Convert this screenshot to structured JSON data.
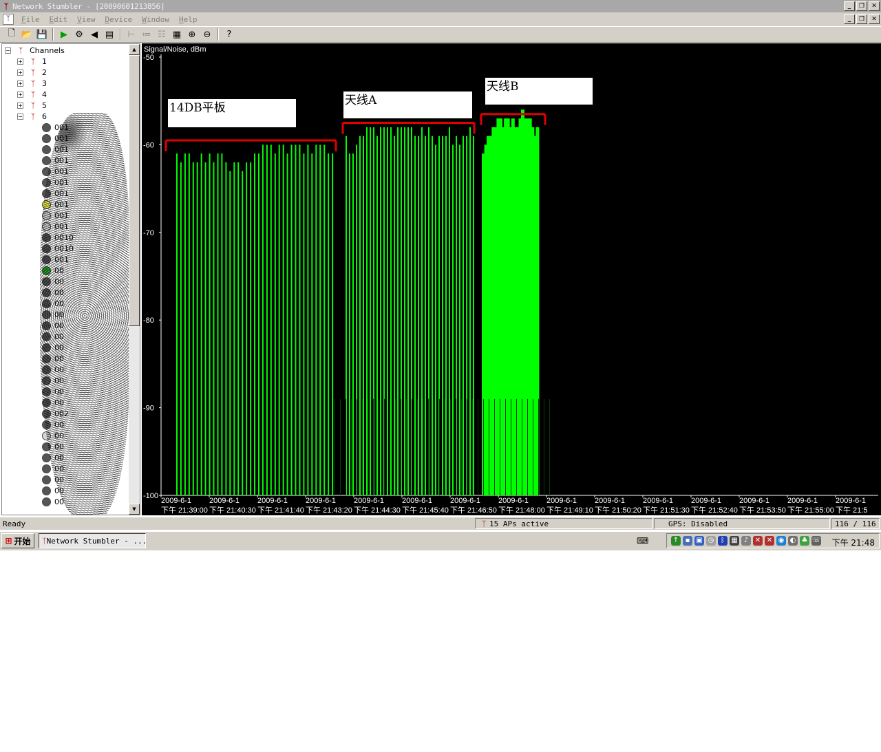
{
  "window": {
    "title": "Network Stumbler - [20090601213856]",
    "controls": [
      "_",
      "❐",
      "✕"
    ]
  },
  "menu": {
    "items": [
      "File",
      "Edit",
      "View",
      "Device",
      "Window",
      "Help"
    ]
  },
  "toolbar": {
    "icons": [
      "new-icon",
      "open-icon",
      "save-icon",
      "play-icon",
      "auto-config-icon",
      "scan-speed-icon",
      "properties-icon",
      "tree-icon",
      "list-icon",
      "columns-icon",
      "grid-icon",
      "zoom-in-icon",
      "zoom-out-icon",
      "help-icon"
    ]
  },
  "tree": {
    "root_label": "Channels",
    "channels": [
      "1",
      "2",
      "3",
      "4",
      "5",
      "6"
    ],
    "ap_rows": [
      {
        "label": "001",
        "icon": "lock"
      },
      {
        "label": "001",
        "icon": "lock"
      },
      {
        "label": "001",
        "icon": "lock"
      },
      {
        "label": "001",
        "icon": "lock"
      },
      {
        "label": "001",
        "icon": "lock"
      },
      {
        "label": "001",
        "icon": "lock"
      },
      {
        "label": "001",
        "icon": "lock"
      },
      {
        "label": "001",
        "icon": "yellow"
      },
      {
        "label": "001",
        "icon": "open"
      },
      {
        "label": "001",
        "icon": "open"
      },
      {
        "label": "0010",
        "icon": "lock"
      },
      {
        "label": "0010",
        "icon": "lock"
      },
      {
        "label": "001",
        "icon": "lock"
      },
      {
        "label": "00",
        "icon": "green"
      },
      {
        "label": "00",
        "icon": "lock"
      },
      {
        "label": "00",
        "icon": "lock"
      },
      {
        "label": "00",
        "icon": "lock"
      },
      {
        "label": "00",
        "icon": "lock"
      },
      {
        "label": "00",
        "icon": "lock"
      },
      {
        "label": "00",
        "icon": "lock"
      },
      {
        "label": "00",
        "icon": "lock"
      },
      {
        "label": "00",
        "icon": "lock"
      },
      {
        "label": "00",
        "icon": "lock"
      },
      {
        "label": "00",
        "icon": "lock"
      },
      {
        "label": "00",
        "icon": "lock"
      },
      {
        "label": "00",
        "icon": "lock"
      },
      {
        "label": "002",
        "icon": "lock"
      },
      {
        "label": "00",
        "icon": "lock"
      },
      {
        "label": "00",
        "icon": "open"
      },
      {
        "label": "00",
        "icon": "lock"
      },
      {
        "label": "00",
        "icon": "lock"
      },
      {
        "label": "00",
        "icon": "lock"
      },
      {
        "label": "00",
        "icon": "lock"
      },
      {
        "label": "00",
        "icon": "lock"
      },
      {
        "label": "00",
        "icon": "lock"
      }
    ]
  },
  "chart_data": {
    "type": "bar",
    "title": "",
    "ylabel": "Signal/Noise, dBm",
    "ylim": [
      -100,
      -50
    ],
    "yticks": [
      "-50",
      "-60",
      "-70",
      "-80",
      "-90",
      "-100"
    ],
    "grid": false,
    "x_tick_labels": [
      {
        "date": "2009-6-1",
        "time": "下午 21:39:00"
      },
      {
        "date": "2009-6-1",
        "time": "下午 21:40:30"
      },
      {
        "date": "2009-6-1",
        "time": "下午 21:41:40"
      },
      {
        "date": "2009-6-1",
        "time": "下午 21:43:20"
      },
      {
        "date": "2009-6-1",
        "time": "下午 21:44:30"
      },
      {
        "date": "2009-6-1",
        "time": "下午 21:45:40"
      },
      {
        "date": "2009-6-1",
        "time": "下午 21:46:50"
      },
      {
        "date": "2009-6-1",
        "time": "下午 21:48:00"
      },
      {
        "date": "2009-6-1",
        "time": "下午 21:49:10"
      },
      {
        "date": "2009-6-1",
        "time": "下午 21:50:20"
      },
      {
        "date": "2009-6-1",
        "time": "下午 21:51:30"
      },
      {
        "date": "2009-6-1",
        "time": "下午 21:52:40"
      },
      {
        "date": "2009-6-1",
        "time": "下午 21:53:50"
      },
      {
        "date": "2009-6-1",
        "time": "下午 21:55:00"
      },
      {
        "date": "2009-6-1",
        "time": "下午 21:5"
      }
    ],
    "series": [
      {
        "color": "#00ff00",
        "group_a": [
          -61,
          -62,
          -61,
          -61,
          -62,
          -62,
          -61,
          -62,
          -61,
          -62,
          -61,
          -61,
          -62,
          -63,
          -62,
          -62,
          -63,
          -62,
          -62,
          -61,
          -61,
          -60,
          -60,
          -60,
          -61,
          -60,
          -60,
          -61,
          -60,
          -60,
          -60,
          -61,
          -60,
          -61,
          -60,
          -60,
          -60,
          -61,
          -61
        ],
        "group_b": [
          -59,
          -61,
          -61,
          -60,
          -59,
          -59,
          -58,
          -58,
          -58,
          -59,
          -58,
          -58,
          -58,
          -58,
          -59,
          -58,
          -58,
          -58,
          -58,
          -58,
          -59,
          -59,
          -58,
          -59,
          -58,
          -59,
          -60,
          -59,
          -59,
          -59,
          -58,
          -60,
          -59,
          -60,
          -59,
          -59,
          -58,
          -59
        ],
        "group_c": [
          -61,
          -60,
          -59,
          -59,
          -58,
          -58,
          -57,
          -57,
          -58,
          -57,
          -57,
          -58,
          -57,
          -58,
          -58,
          -57,
          -56,
          -57,
          -57,
          -57,
          -58,
          -59,
          -58
        ]
      }
    ],
    "annotations": [
      {
        "text": "14DB平板",
        "start_time": "下午 21:39:00",
        "end_time": "下午 21:43:20",
        "level_dbm": -59.5
      },
      {
        "text": "天线A",
        "start_time": "下午 21:43:20",
        "end_time": "下午 21:46:50",
        "level_dbm": -57.5
      },
      {
        "text": "天线B",
        "start_time": "下午 21:46:50",
        "end_time": "下午 21:48:00",
        "level_dbm": -56.5
      }
    ]
  },
  "status": {
    "ready": "Ready",
    "aps_active": "15 APs active",
    "gps": "GPS: Disabled",
    "count": "116 / 116"
  },
  "taskbar": {
    "start_label": "开始",
    "task_label": "Network Stumbler - ...",
    "clock": "下午 21:48"
  },
  "colors": {
    "signal": "#00ff00",
    "annotation_line": "#e00000",
    "graph_bg": "#000000"
  }
}
